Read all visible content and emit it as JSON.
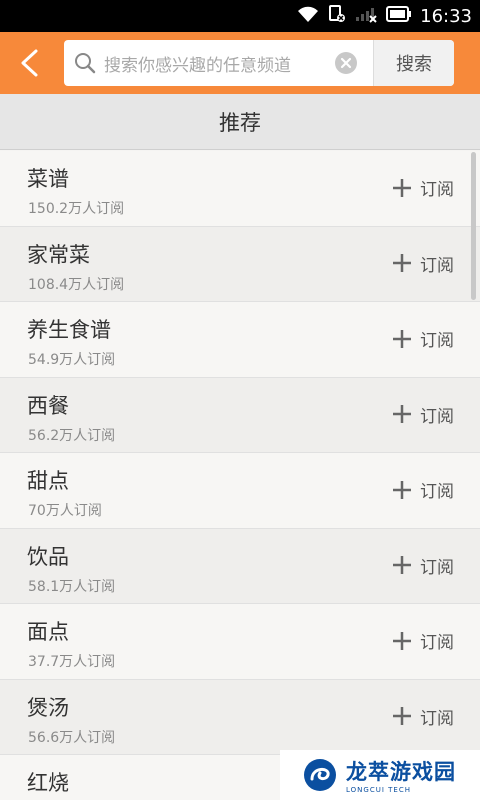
{
  "status_bar": {
    "time": "16:33"
  },
  "header": {
    "search_placeholder": "搜索你感兴趣的任意频道",
    "search_button": "搜索"
  },
  "section": {
    "title": "推荐"
  },
  "items": [
    {
      "name": "菜谱",
      "subscribers": "150.2万人订阅",
      "action": "订阅"
    },
    {
      "name": "家常菜",
      "subscribers": "108.4万人订阅",
      "action": "订阅"
    },
    {
      "name": "养生食谱",
      "subscribers": "54.9万人订阅",
      "action": "订阅"
    },
    {
      "name": "西餐",
      "subscribers": "56.2万人订阅",
      "action": "订阅"
    },
    {
      "name": "甜点",
      "subscribers": "70万人订阅",
      "action": "订阅"
    },
    {
      "name": "饮品",
      "subscribers": "58.1万人订阅",
      "action": "订阅"
    },
    {
      "name": "面点",
      "subscribers": "37.7万人订阅",
      "action": "订阅"
    },
    {
      "name": "煲汤",
      "subscribers": "56.6万人订阅",
      "action": "订阅"
    },
    {
      "name": "红烧",
      "subscribers": "",
      "action": ""
    }
  ],
  "watermark": {
    "title": "龙萃游戏园",
    "subtitle": "LONGCUI TECH"
  },
  "colors": {
    "accent": "#f7893a",
    "watermark": "#0b4fa0"
  }
}
